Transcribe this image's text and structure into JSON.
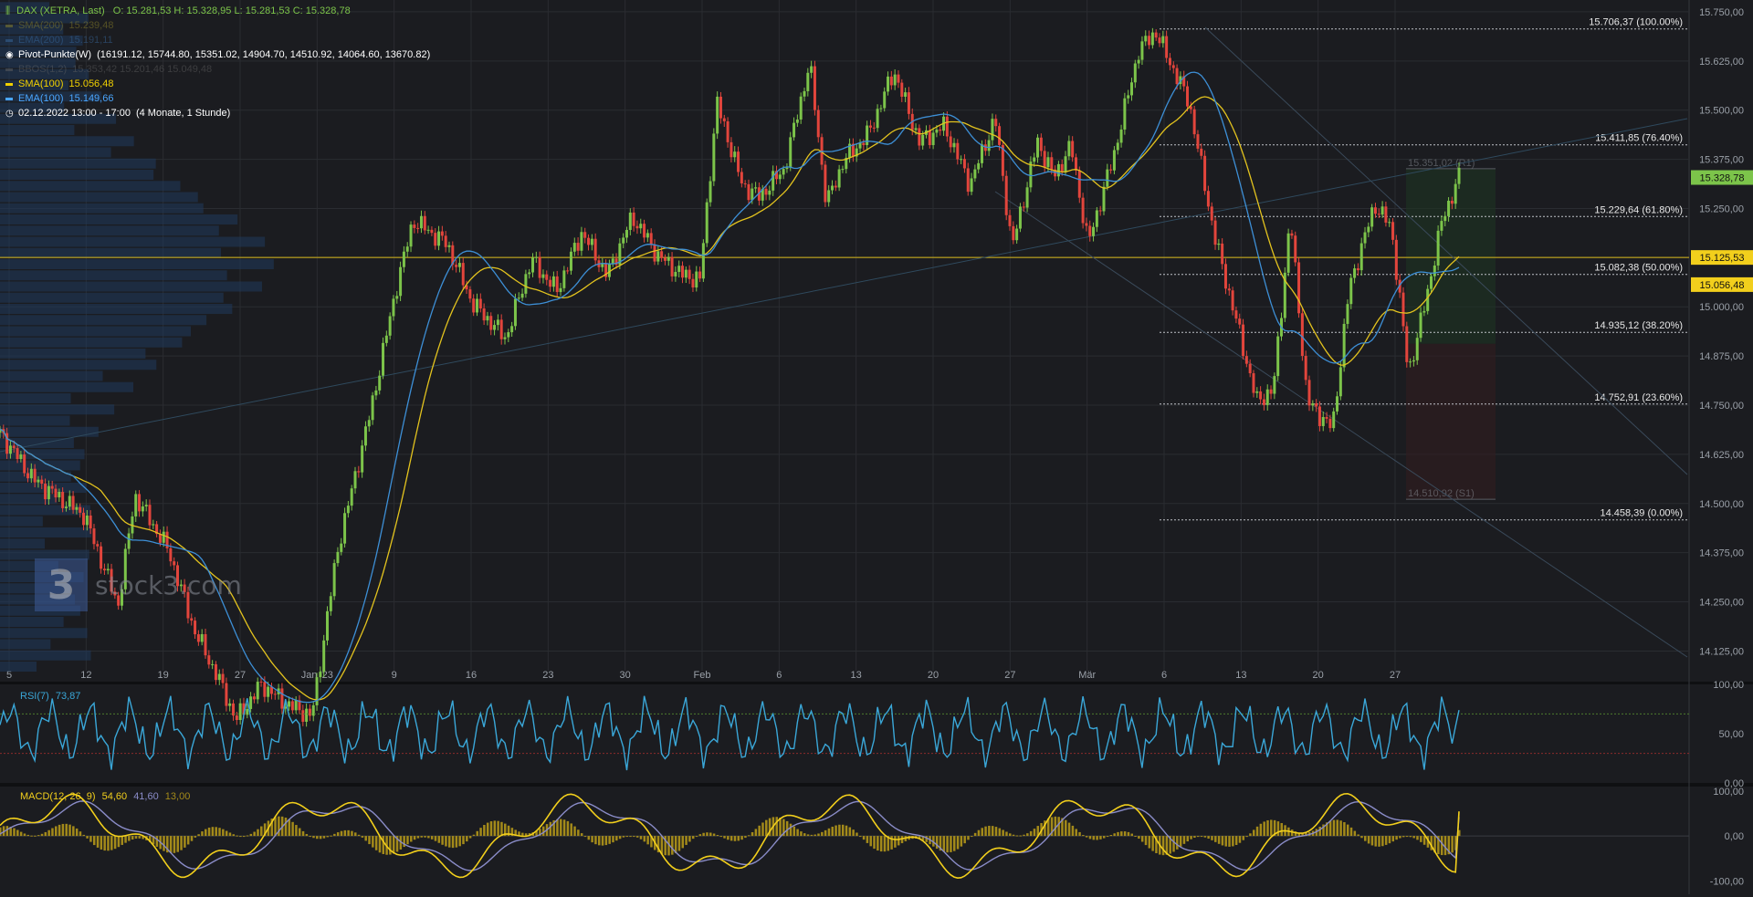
{
  "header": {
    "title_icon": "bar-chart-icon",
    "title": "DAX (XETRA, Last)",
    "ohlc": "O: 15.281,53  H: 15.328,95  L: 15.281,53  C: 15.328,78",
    "indicators": [
      {
        "label": "SMA(200)",
        "value": "15.239,48",
        "color": "#9a8f2a",
        "dim": true
      },
      {
        "label": "EMA(200)",
        "value": "15.191,11",
        "color": "#3a6fa8",
        "dim": true
      },
      {
        "label": "Pivot-Punkte(W)",
        "value": "(16191.12, 15744.80, 15351.02, 14904.70, 14510.92, 14064.60, 13670.82)",
        "color": "#ffffff",
        "dim": false,
        "icon": "radio-icon"
      },
      {
        "label": "BBOS(1,2)",
        "value": "15.353,42  15.201,46  15.049,48",
        "color": "#666666",
        "dim": true
      },
      {
        "label": "SMA(100)",
        "value": "15.056,48",
        "color": "#f0d000",
        "dim": false
      },
      {
        "label": "EMA(100)",
        "value": "15.149,66",
        "color": "#4aa6ff",
        "dim": false
      },
      {
        "label": "02.12.2022 13:00 - 17:00",
        "value": "(4 Monate, 1 Stunde)",
        "color": "#ffffff",
        "dim": false,
        "icon": "clock-icon"
      }
    ],
    "rsi_label": "RSI(7)",
    "rsi_value": "73,87",
    "macd_label": "MACD(12, 26, 9)",
    "macd_value": "54,60",
    "macd_signal": "41,60",
    "macd_hist": "13,00"
  },
  "watermark": {
    "logo_text": "3",
    "brand": "stock3.com"
  },
  "colors": {
    "bg": "#1b1c20",
    "grid": "#2a2c31",
    "up": "#7cc44a",
    "down": "#e2453c",
    "sma100": "#e3c31e",
    "ema100": "#3d8fd6",
    "rsi": "#3aa7d8",
    "macd": "#f2cf1c",
    "signal": "#8a8cc8",
    "hist": "#a38a1a"
  },
  "chart_data": [
    {
      "type": "candlestick",
      "title": "DAX (XETRA, Last)",
      "timeframe": "1 Stunde",
      "ylim": [
        14075,
        15780
      ],
      "y_ticks": [
        "14.125,00",
        "14.250,00",
        "14.375,00",
        "14.500,00",
        "14.625,00",
        "14.750,00",
        "14.875,00",
        "15.000,00",
        "15.125,00",
        "15.250,00",
        "15.375,00",
        "15.500,00",
        "15.625,00",
        "15.750,00"
      ],
      "y_tick_values": [
        14125,
        14250,
        14375,
        14500,
        14625,
        14750,
        14875,
        15000,
        15125,
        15250,
        15375,
        15500,
        15625,
        15750
      ],
      "x_ticks": [
        "5",
        "12",
        "19",
        "27",
        "Jan '23",
        "9",
        "16",
        "23",
        "30",
        "Feb",
        "6",
        "13",
        "20",
        "27",
        "Mär",
        "6",
        "13",
        "20",
        "27"
      ],
      "price_tags": [
        {
          "label": "15.328,78",
          "value": 15328.78,
          "color": "#7cc44a"
        },
        {
          "label": "15.125,53",
          "value": 15125.53,
          "color": "#f2cf1c"
        },
        {
          "label": "15.056,48",
          "value": 15056.48,
          "color": "#f2cf1c"
        }
      ],
      "fibonacci": [
        {
          "label": "15.706,37 (100.00%)",
          "value": 15706.37
        },
        {
          "label": "15.411,85 (76.40%)",
          "value": 15411.85
        },
        {
          "label": "15.229,64 (61.80%)",
          "value": 15229.64
        },
        {
          "label": "15.082,38 (50.00%)",
          "value": 15082.38
        },
        {
          "label": "14.935,12 (38.20%)",
          "value": 14935.12
        },
        {
          "label": "14.752,91 (23.60%)",
          "value": 14752.91
        },
        {
          "label": "14.458,39 (0.00%)",
          "value": 14458.39
        }
      ],
      "pivots": [
        {
          "label": "15.351,02 (R1)",
          "value": 15351.02
        },
        {
          "label": "14.510,92 (S1)",
          "value": 14510.92
        }
      ],
      "trend_path_x": [
        0,
        0.02,
        0.05,
        0.07,
        0.08,
        0.1,
        0.115,
        0.13,
        0.14,
        0.155,
        0.17,
        0.185,
        0.2,
        0.22,
        0.235,
        0.245,
        0.265,
        0.28,
        0.3,
        0.315,
        0.33,
        0.345,
        0.36,
        0.375,
        0.39,
        0.405,
        0.415,
        0.425,
        0.44,
        0.45,
        0.465,
        0.48,
        0.49,
        0.5,
        0.515,
        0.53,
        0.545,
        0.56,
        0.575,
        0.59,
        0.6,
        0.615,
        0.625,
        0.635,
        0.645,
        0.66,
        0.675,
        0.685,
        0.695,
        0.705,
        0.72,
        0.735,
        0.745,
        0.755,
        0.765,
        0.775,
        0.79,
        0.8,
        0.815,
        0.825,
        0.835,
        0.845,
        0.855,
        0.865
      ],
      "trend_path_y": [
        14680,
        14560,
        14470,
        14240,
        14520,
        14380,
        14180,
        14050,
        13950,
        14040,
        13990,
        13960,
        14380,
        14740,
        15050,
        15220,
        15160,
        15010,
        14920,
        15120,
        15040,
        15190,
        15080,
        15230,
        15130,
        15080,
        15070,
        15520,
        15310,
        15280,
        15350,
        15620,
        15260,
        15370,
        15440,
        15600,
        15420,
        15460,
        15310,
        15480,
        15150,
        15420,
        15330,
        15410,
        15160,
        15380,
        15650,
        15700,
        15610,
        15520,
        15180,
        14930,
        14760,
        14790,
        15230,
        14760,
        14690,
        15050,
        15260,
        15200,
        14830,
        15010,
        15220,
        15330
      ]
    },
    {
      "type": "line",
      "title": "RSI(7)",
      "ylim": [
        0,
        100
      ],
      "y_ticks": [
        "100,00",
        "50,00",
        "0,00"
      ],
      "y_tick_values": [
        100,
        50,
        0
      ],
      "last_value": 73.87,
      "levels": [
        70,
        30
      ]
    },
    {
      "type": "line",
      "title": "MACD(12, 26, 9)",
      "ylim": [
        -130,
        110
      ],
      "y_ticks": [
        "100,00",
        "0,00",
        "-100,00"
      ],
      "y_tick_values": [
        100,
        0,
        -100
      ],
      "macd": 54.6,
      "signal": 41.6,
      "histogram": 13.0
    }
  ]
}
